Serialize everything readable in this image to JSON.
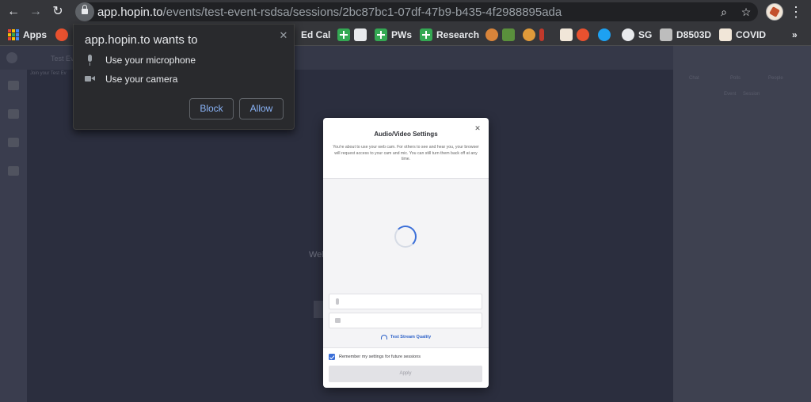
{
  "browser": {
    "url_host": "app.hopin.to",
    "url_path": "/events/test-event-rsdsa/sessions/2bc87bc1-07df-47b9-b435-4f2988895ada"
  },
  "bookmarks": {
    "apps": "Apps",
    "ed_cal": "Ed Cal",
    "pws": "PWs",
    "research": "Research",
    "sg": "SG",
    "d8503d": "D8503D",
    "covid": "COVID",
    "more": "»"
  },
  "permission_prompt": {
    "title": "app.hopin.to wants to",
    "microphone": "Use your microphone",
    "camera": "Use your camera",
    "block": "Block",
    "allow": "Allow"
  },
  "background_app": {
    "tab_label": "Test Ev",
    "sub_label": "Join your Test Ev",
    "welcome": "Wel",
    "right_tabs": [
      "Chat",
      "Polls",
      "People"
    ],
    "right_sub": [
      "Event",
      "Session"
    ]
  },
  "av_modal": {
    "title": "Audio/Video Settings",
    "description": "You're about to use your web cam. For others to see and hear you, your browser will request access to your cam and mic. You can still turn them back off at any time.",
    "test_quality": "Test Stream Quality",
    "remember": "Remember my settings for future sessions",
    "apply": "Apply"
  },
  "colors": {
    "chrome": "#35363a",
    "accent": "#3b6fd8",
    "link": "#8ab4f8"
  }
}
